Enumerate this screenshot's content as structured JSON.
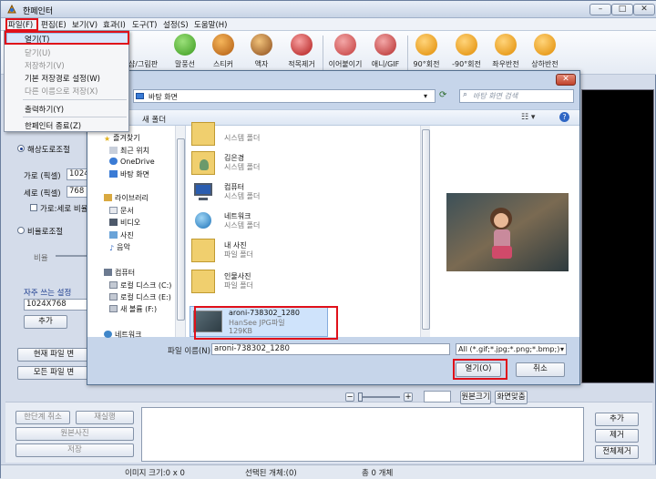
{
  "window": {
    "title": "한페인터",
    "controls": [
      "–",
      "□",
      "✕"
    ]
  },
  "menubar": {
    "items": [
      "파일(F)",
      "편집(E)",
      "보기(V)",
      "효과(I)",
      "도구(T)",
      "설정(S)",
      "도움말(H)"
    ]
  },
  "toolbar": {
    "items": [
      "샵/그림판",
      "말풍선",
      "스티커",
      "액자",
      "적목제거",
      "이어붙이기",
      "애니/GIF",
      "90°회전",
      "-90°회전",
      "좌우반전",
      "상하반전"
    ]
  },
  "file_menu": {
    "items": [
      {
        "label": "열기(T)",
        "enabled": true
      },
      {
        "label": "닫기(U)",
        "enabled": false
      },
      {
        "label": "저장하기(V)",
        "enabled": false
      },
      {
        "label": "기본 저장경로 설정(W)",
        "enabled": true
      },
      {
        "label": "다른 이름으로 저장(X)",
        "enabled": false
      },
      {
        "label": "출력하기(Y)",
        "enabled": true
      },
      {
        "label": "한페인터 종료(Z)",
        "enabled": true
      }
    ]
  },
  "left_panel": {
    "resize_label": "해상도로조절",
    "width_label": "가로 (픽셀)",
    "width_value": "1024",
    "height_label": "세로 (픽셀)",
    "height_value": "768",
    "keep_ratio_label": "가로:세로 비율",
    "ratio_label": "비율로조절",
    "ratio_sub": "비율",
    "preset_label": "자주 쓰는 설정",
    "preset_value": "1024X768",
    "add_button": "추가",
    "current_file_button": "현재 파일 변",
    "all_files_button": "모든 파일 변"
  },
  "dialog": {
    "close": "✕",
    "address": "바탕 화면",
    "search_placeholder": "바탕 화면 검색",
    "new_folder": "새 폴더",
    "nav": {
      "favorites": "즐겨찾기",
      "favorites_items": [
        "최근 위치",
        "OneDrive",
        "바탕 화면"
      ],
      "libraries": "라이브러리",
      "library_items": [
        "문서",
        "비디오",
        "사진",
        "음악"
      ],
      "computer": "컴퓨터",
      "computer_items": [
        "로컬 디스크 (C:)",
        "로컬 디스크 (E:)",
        "새 볼륨 (F:)"
      ],
      "network": "네트워크"
    },
    "files": [
      {
        "name": "",
        "type": "시스템 폴더",
        "icon": "folder-icon"
      },
      {
        "name": "김은경",
        "type": "시스템 폴더",
        "icon": "user-folder-icon"
      },
      {
        "name": "컴퓨터",
        "type": "시스템 폴더",
        "icon": "computer-icon"
      },
      {
        "name": "네트워크",
        "type": "시스템 폴더",
        "icon": "network-icon"
      },
      {
        "name": "내 사진",
        "type": "파일 폴더",
        "icon": "folder-icon"
      },
      {
        "name": "인물사진",
        "type": "파일 폴더",
        "icon": "folder-icon"
      },
      {
        "name": "aroni-738302_1280",
        "type": "HanSee JPG파일",
        "size": "129KB",
        "icon": "image-thumb-icon"
      }
    ],
    "filename_label": "파일 이름(N):",
    "filename_value": "aroni-738302_1280",
    "filter_value": "All (*.gif;*.jpg;*.png;*.bmp;)",
    "open_button": "열기(O)",
    "cancel_button": "취소"
  },
  "bottom": {
    "undo": "한단계 취소",
    "redo": "재실행",
    "original": "원본사진",
    "save": "저장",
    "zoom_original": "원본크기",
    "zoom_fit": "화면맞춤",
    "add": "추가",
    "remove": "제거",
    "remove_all": "전체제거"
  },
  "status": {
    "image_size": "이미지 크기:0 x 0",
    "selected": "선택된 개체:(0)",
    "total": "총 0 개체"
  }
}
